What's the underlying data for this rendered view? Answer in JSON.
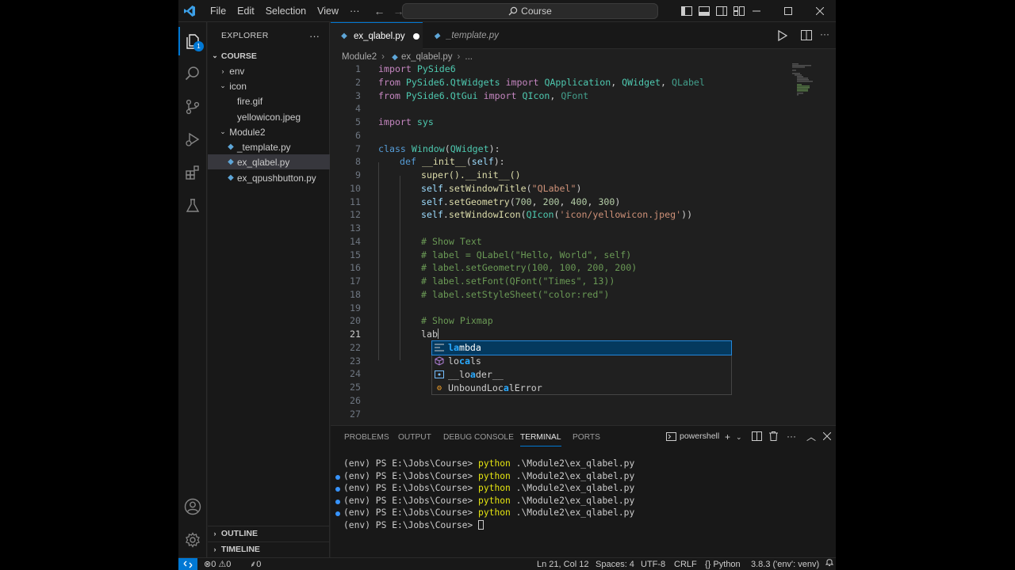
{
  "titlebar": {
    "menu": [
      "File",
      "Edit",
      "Selection",
      "View",
      "···"
    ],
    "search": "Course"
  },
  "activity": {
    "explorer_badge": "1"
  },
  "sidebar": {
    "title": "EXPLORER",
    "more": "···",
    "root": "COURSE",
    "tree": [
      {
        "label": "env",
        "type": "folder",
        "open": false
      },
      {
        "label": "icon",
        "type": "folder",
        "open": true
      },
      {
        "label": "fire.gif",
        "type": "file"
      },
      {
        "label": "yellowicon.jpeg",
        "type": "file"
      },
      {
        "label": "Module2",
        "type": "folder",
        "open": true
      },
      {
        "label": "_template.py",
        "type": "py"
      },
      {
        "label": "ex_qlabel.py",
        "type": "py",
        "selected": true
      },
      {
        "label": "ex_qpushbutton.py",
        "type": "py"
      }
    ],
    "outline": "OUTLINE",
    "timeline": "TIMELINE"
  },
  "editor": {
    "tabs": [
      {
        "label": "ex_qlabel.py",
        "active": true,
        "modified": true
      },
      {
        "label": "_template.py",
        "active": false
      }
    ],
    "breadcrumb": {
      "folder": "Module2",
      "file": "ex_qlabel.py",
      "more": "..."
    },
    "line_numbers": [
      "1",
      "2",
      "3",
      "4",
      "5",
      "6",
      "7",
      "8",
      "9",
      "10",
      "11",
      "12",
      "13",
      "14",
      "15",
      "16",
      "17",
      "18",
      "19",
      "20",
      "21",
      "22",
      "23",
      "24",
      "25",
      "26",
      "27"
    ],
    "current_line": "21",
    "code": {
      "l1": "import PySide6",
      "l2": "from PySide6.QtWidgets import QApplication, QWidget, QLabel",
      "l3": "from PySide6.QtGui import QIcon, QFont",
      "l5": "import sys",
      "l7": "class Window(QWidget):",
      "l8": "def __init__(self):",
      "l9": "super().__init__()",
      "l10": "self.setWindowTitle(\"QLabel\")",
      "l11": "self.setGeometry(700, 200, 400, 300)",
      "l12": "self.setWindowIcon(QIcon('icon/yellowicon.jpeg'))",
      "l14": "# Show Text",
      "l15": "# label = QLabel(\"Hello, World\", self)",
      "l16": "# label.setGeometry(100, 100, 200, 200)",
      "l17": "# label.setFont(QFont(\"Times\", 13))",
      "l18": "# label.setStyleSheet(\"color:red\")",
      "l20": "# Show Pixmap",
      "l21": "lab"
    },
    "suggestions": [
      "lambda",
      "locals",
      "__loader__",
      "UnboundLocalError"
    ]
  },
  "panel": {
    "tabs": [
      "PROBLEMS",
      "OUTPUT",
      "DEBUG CONSOLE",
      "TERMINAL",
      "PORTS"
    ],
    "active_tab": "TERMINAL",
    "shell": "powershell",
    "terminal_lines": [
      {
        "prompt": "(env) PS E:\\Jobs\\Course> ",
        "cmd": "python",
        "args": " .\\Module2\\ex_qlabel.py",
        "dot": false
      },
      {
        "prompt": "(env) PS E:\\Jobs\\Course> ",
        "cmd": "python",
        "args": " .\\Module2\\ex_qlabel.py",
        "dot": true
      },
      {
        "prompt": "(env) PS E:\\Jobs\\Course> ",
        "cmd": "python",
        "args": " .\\Module2\\ex_qlabel.py",
        "dot": true
      },
      {
        "prompt": "(env) PS E:\\Jobs\\Course> ",
        "cmd": "python",
        "args": " .\\Module2\\ex_qlabel.py",
        "dot": true
      },
      {
        "prompt": "(env) PS E:\\Jobs\\Course> ",
        "cmd": "python",
        "args": " .\\Module2\\ex_qlabel.py",
        "dot": true
      },
      {
        "prompt": "(env) PS E:\\Jobs\\Course> ",
        "cmd": "",
        "args": "",
        "dot": false
      }
    ]
  },
  "statusbar": {
    "errors": "0",
    "warnings": "0",
    "ports": "0",
    "position": "Ln 21, Col 12",
    "spaces": "Spaces: 4",
    "encoding": "UTF-8",
    "eol": "CRLF",
    "language": "Python",
    "interpreter": "3.8.3 ('env': venv)"
  },
  "colors": {
    "accent": "#0078d4",
    "keyword": "#c586c0",
    "class": "#4ec9b0",
    "string": "#ce9178",
    "comment": "#6a9955"
  }
}
